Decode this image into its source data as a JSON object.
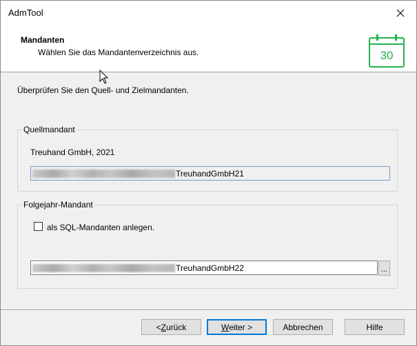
{
  "window": {
    "title": "AdmTool"
  },
  "header": {
    "title": "Mandanten",
    "subtitle": "Wählen Sie das Mandantenverzeichnis aus.",
    "calendar_day": "30",
    "calendar_color": "#22b14c",
    "calendar_icon": "calendar-icon"
  },
  "instruction": "Überprüfen Sie den Quell- und Zielmandanten.",
  "source_group": {
    "legend": "Quellmandant",
    "company": "Treuhand GmbH, 2021",
    "path_suffix": "TreuhandGmbH21"
  },
  "target_group": {
    "legend": "Folgejahr-Mandant",
    "sql_checkbox_label": "als SQL-Mandanten anlegen.",
    "sql_checked": false,
    "path_suffix": "TreuhandGmbH22",
    "browse_label": "..."
  },
  "buttons": {
    "back_prefix": "< ",
    "back_mnemonic": "Z",
    "back_rest": "urück",
    "next_mnemonic": "W",
    "next_rest": "eiter >",
    "cancel": "Abbrechen",
    "help": "Hilfe"
  }
}
